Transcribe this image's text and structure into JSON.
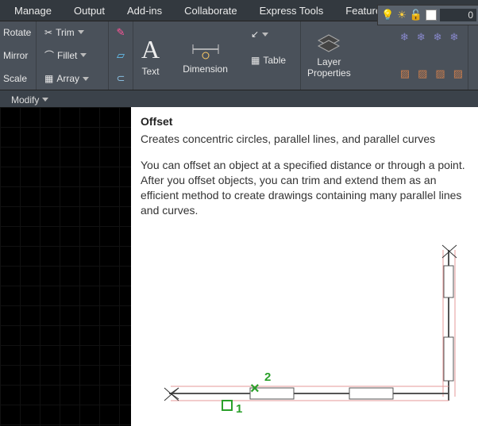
{
  "menubar": [
    "Manage",
    "Output",
    "Add-ins",
    "Collaborate",
    "Express Tools",
    "Featured Apps"
  ],
  "ribbon": {
    "modify": {
      "rotate": "Rotate",
      "mirror": "Mirror",
      "scale": "Scale",
      "trim": "Trim",
      "fillet": "Fillet",
      "array": "Array"
    },
    "text": {
      "label": "Text"
    },
    "dimension": {
      "label": "Dimension"
    },
    "table": {
      "label": "Table"
    },
    "layer": {
      "label": "Layer\nProperties"
    },
    "layerstate": {
      "value": "0"
    }
  },
  "doctab": {
    "label": "Modify"
  },
  "help": {
    "title": "Offset",
    "subtitle": "Creates concentric circles, parallel lines, and parallel curves",
    "body": "You can offset an object at a specified distance or through a point. After you offset objects, you can trim and extend them as an efficient method to create drawings containing many parallel lines and curves.",
    "marker1": "1",
    "marker2": "2",
    "cross": "×"
  }
}
